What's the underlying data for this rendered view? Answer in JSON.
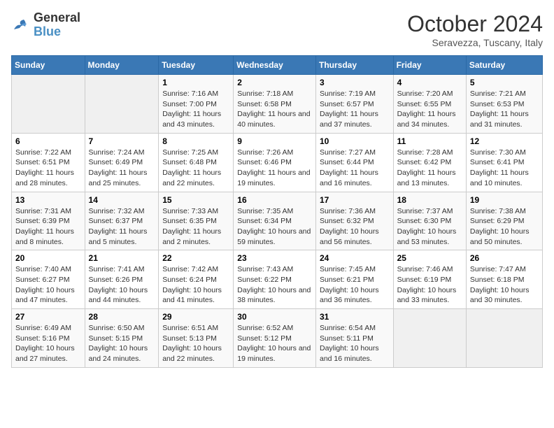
{
  "header": {
    "logo_line1": "General",
    "logo_line2": "Blue",
    "month": "October 2024",
    "location": "Seravezza, Tuscany, Italy"
  },
  "weekdays": [
    "Sunday",
    "Monday",
    "Tuesday",
    "Wednesday",
    "Thursday",
    "Friday",
    "Saturday"
  ],
  "weeks": [
    [
      {
        "day": "",
        "info": ""
      },
      {
        "day": "",
        "info": ""
      },
      {
        "day": "1",
        "info": "Sunrise: 7:16 AM\nSunset: 7:00 PM\nDaylight: 11 hours and 43 minutes."
      },
      {
        "day": "2",
        "info": "Sunrise: 7:18 AM\nSunset: 6:58 PM\nDaylight: 11 hours and 40 minutes."
      },
      {
        "day": "3",
        "info": "Sunrise: 7:19 AM\nSunset: 6:57 PM\nDaylight: 11 hours and 37 minutes."
      },
      {
        "day": "4",
        "info": "Sunrise: 7:20 AM\nSunset: 6:55 PM\nDaylight: 11 hours and 34 minutes."
      },
      {
        "day": "5",
        "info": "Sunrise: 7:21 AM\nSunset: 6:53 PM\nDaylight: 11 hours and 31 minutes."
      }
    ],
    [
      {
        "day": "6",
        "info": "Sunrise: 7:22 AM\nSunset: 6:51 PM\nDaylight: 11 hours and 28 minutes."
      },
      {
        "day": "7",
        "info": "Sunrise: 7:24 AM\nSunset: 6:49 PM\nDaylight: 11 hours and 25 minutes."
      },
      {
        "day": "8",
        "info": "Sunrise: 7:25 AM\nSunset: 6:48 PM\nDaylight: 11 hours and 22 minutes."
      },
      {
        "day": "9",
        "info": "Sunrise: 7:26 AM\nSunset: 6:46 PM\nDaylight: 11 hours and 19 minutes."
      },
      {
        "day": "10",
        "info": "Sunrise: 7:27 AM\nSunset: 6:44 PM\nDaylight: 11 hours and 16 minutes."
      },
      {
        "day": "11",
        "info": "Sunrise: 7:28 AM\nSunset: 6:42 PM\nDaylight: 11 hours and 13 minutes."
      },
      {
        "day": "12",
        "info": "Sunrise: 7:30 AM\nSunset: 6:41 PM\nDaylight: 11 hours and 10 minutes."
      }
    ],
    [
      {
        "day": "13",
        "info": "Sunrise: 7:31 AM\nSunset: 6:39 PM\nDaylight: 11 hours and 8 minutes."
      },
      {
        "day": "14",
        "info": "Sunrise: 7:32 AM\nSunset: 6:37 PM\nDaylight: 11 hours and 5 minutes."
      },
      {
        "day": "15",
        "info": "Sunrise: 7:33 AM\nSunset: 6:35 PM\nDaylight: 11 hours and 2 minutes."
      },
      {
        "day": "16",
        "info": "Sunrise: 7:35 AM\nSunset: 6:34 PM\nDaylight: 10 hours and 59 minutes."
      },
      {
        "day": "17",
        "info": "Sunrise: 7:36 AM\nSunset: 6:32 PM\nDaylight: 10 hours and 56 minutes."
      },
      {
        "day": "18",
        "info": "Sunrise: 7:37 AM\nSunset: 6:30 PM\nDaylight: 10 hours and 53 minutes."
      },
      {
        "day": "19",
        "info": "Sunrise: 7:38 AM\nSunset: 6:29 PM\nDaylight: 10 hours and 50 minutes."
      }
    ],
    [
      {
        "day": "20",
        "info": "Sunrise: 7:40 AM\nSunset: 6:27 PM\nDaylight: 10 hours and 47 minutes."
      },
      {
        "day": "21",
        "info": "Sunrise: 7:41 AM\nSunset: 6:26 PM\nDaylight: 10 hours and 44 minutes."
      },
      {
        "day": "22",
        "info": "Sunrise: 7:42 AM\nSunset: 6:24 PM\nDaylight: 10 hours and 41 minutes."
      },
      {
        "day": "23",
        "info": "Sunrise: 7:43 AM\nSunset: 6:22 PM\nDaylight: 10 hours and 38 minutes."
      },
      {
        "day": "24",
        "info": "Sunrise: 7:45 AM\nSunset: 6:21 PM\nDaylight: 10 hours and 36 minutes."
      },
      {
        "day": "25",
        "info": "Sunrise: 7:46 AM\nSunset: 6:19 PM\nDaylight: 10 hours and 33 minutes."
      },
      {
        "day": "26",
        "info": "Sunrise: 7:47 AM\nSunset: 6:18 PM\nDaylight: 10 hours and 30 minutes."
      }
    ],
    [
      {
        "day": "27",
        "info": "Sunrise: 6:49 AM\nSunset: 5:16 PM\nDaylight: 10 hours and 27 minutes."
      },
      {
        "day": "28",
        "info": "Sunrise: 6:50 AM\nSunset: 5:15 PM\nDaylight: 10 hours and 24 minutes."
      },
      {
        "day": "29",
        "info": "Sunrise: 6:51 AM\nSunset: 5:13 PM\nDaylight: 10 hours and 22 minutes."
      },
      {
        "day": "30",
        "info": "Sunrise: 6:52 AM\nSunset: 5:12 PM\nDaylight: 10 hours and 19 minutes."
      },
      {
        "day": "31",
        "info": "Sunrise: 6:54 AM\nSunset: 5:11 PM\nDaylight: 10 hours and 16 minutes."
      },
      {
        "day": "",
        "info": ""
      },
      {
        "day": "",
        "info": ""
      }
    ]
  ]
}
